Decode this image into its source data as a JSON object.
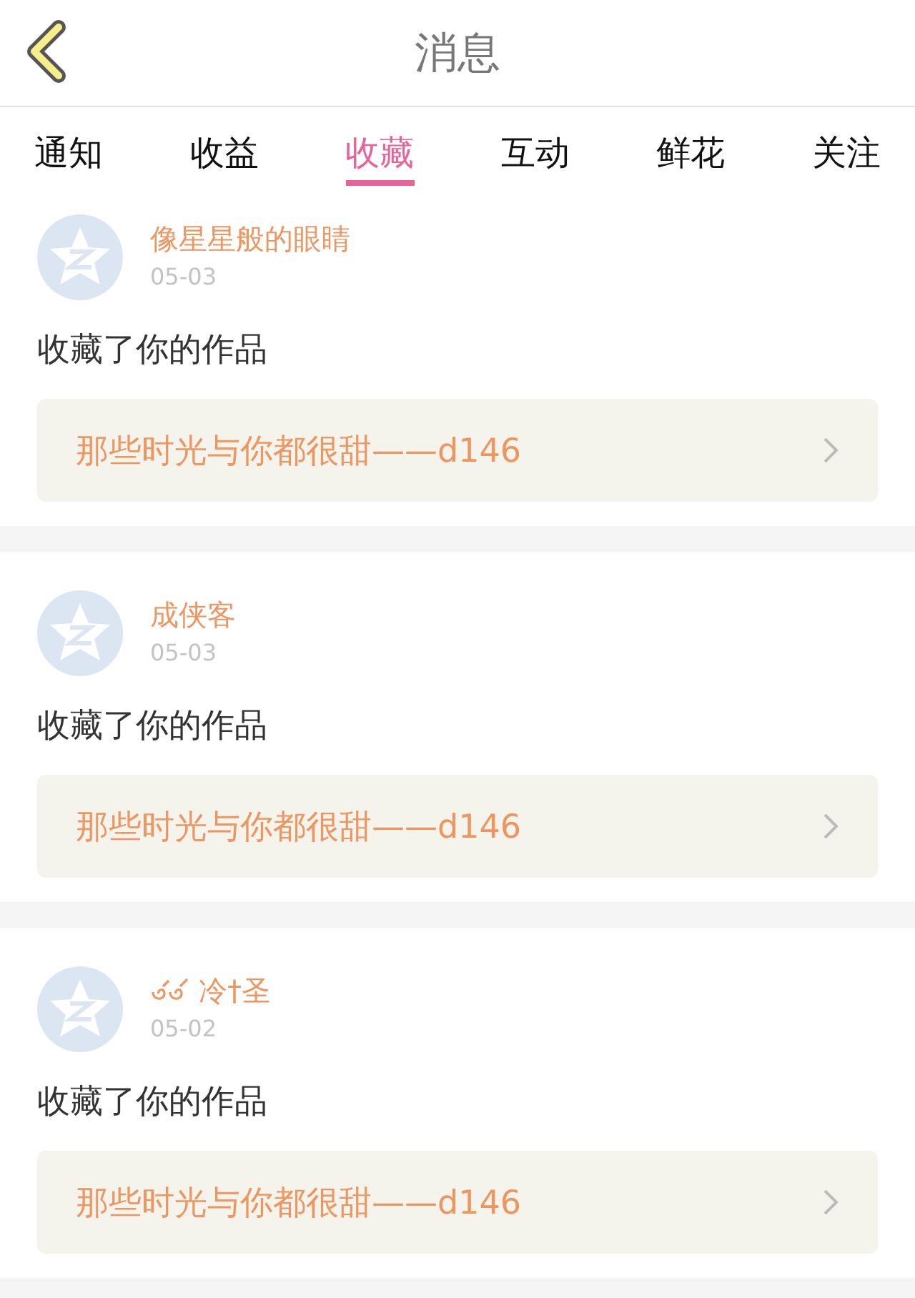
{
  "header": {
    "title": "消息"
  },
  "tabs": [
    {
      "label": "通知",
      "selected": false
    },
    {
      "label": "收益",
      "selected": false
    },
    {
      "label": "收藏",
      "selected": true
    },
    {
      "label": "互动",
      "selected": false
    },
    {
      "label": "鲜花",
      "selected": false
    },
    {
      "label": "关注",
      "selected": false
    }
  ],
  "messages": [
    {
      "user": "像星星般的眼睛",
      "decorated": false,
      "date": "05-03",
      "action": "收藏了你的作品",
      "work": "那些时光与你都很甜——d146"
    },
    {
      "user": "成侠客",
      "decorated": false,
      "date": "05-03",
      "action": "收藏了你的作品",
      "work": "那些时光与你都很甜——d146"
    },
    {
      "user": "冷†圣",
      "decorated": true,
      "date": "05-02",
      "action": "收藏了你的作品",
      "work": "那些时光与你都很甜——d146"
    }
  ]
}
